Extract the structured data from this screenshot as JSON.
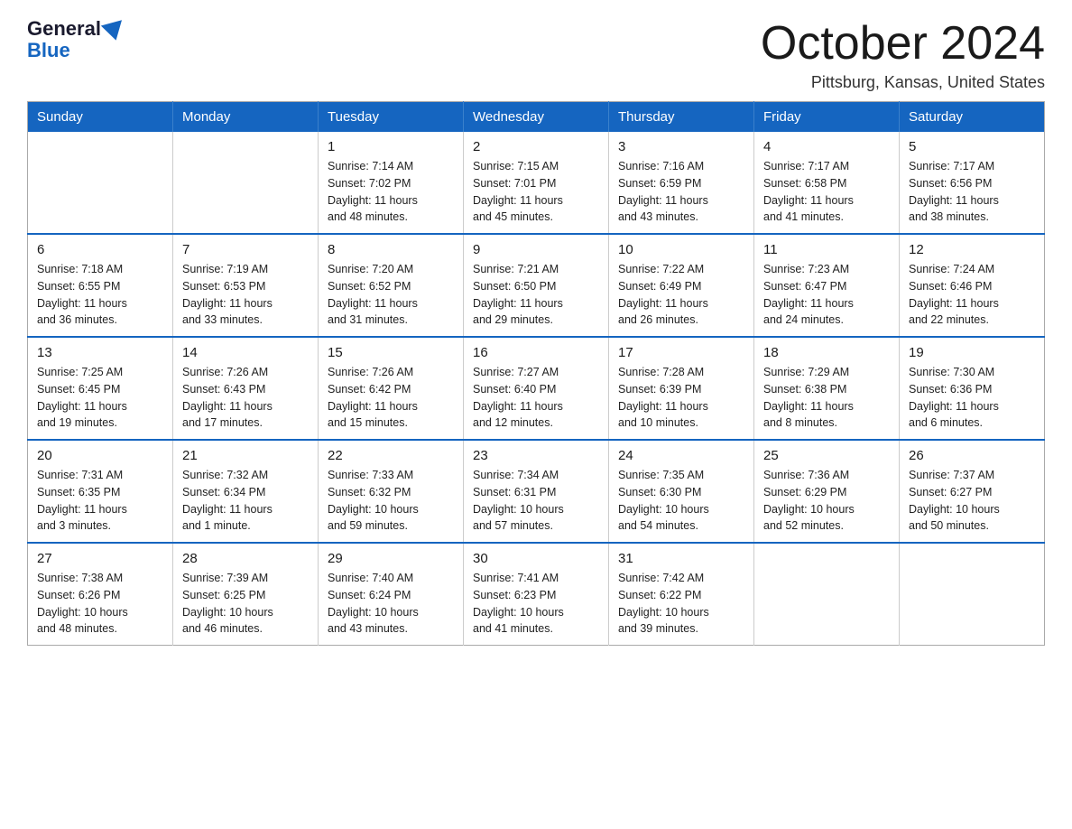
{
  "header": {
    "logo_general": "General",
    "logo_blue": "Blue",
    "month_title": "October 2024",
    "location": "Pittsburg, Kansas, United States"
  },
  "days_of_week": [
    "Sunday",
    "Monday",
    "Tuesday",
    "Wednesday",
    "Thursday",
    "Friday",
    "Saturday"
  ],
  "weeks": [
    [
      {
        "day": "",
        "info": ""
      },
      {
        "day": "",
        "info": ""
      },
      {
        "day": "1",
        "info": "Sunrise: 7:14 AM\nSunset: 7:02 PM\nDaylight: 11 hours\nand 48 minutes."
      },
      {
        "day": "2",
        "info": "Sunrise: 7:15 AM\nSunset: 7:01 PM\nDaylight: 11 hours\nand 45 minutes."
      },
      {
        "day": "3",
        "info": "Sunrise: 7:16 AM\nSunset: 6:59 PM\nDaylight: 11 hours\nand 43 minutes."
      },
      {
        "day": "4",
        "info": "Sunrise: 7:17 AM\nSunset: 6:58 PM\nDaylight: 11 hours\nand 41 minutes."
      },
      {
        "day": "5",
        "info": "Sunrise: 7:17 AM\nSunset: 6:56 PM\nDaylight: 11 hours\nand 38 minutes."
      }
    ],
    [
      {
        "day": "6",
        "info": "Sunrise: 7:18 AM\nSunset: 6:55 PM\nDaylight: 11 hours\nand 36 minutes."
      },
      {
        "day": "7",
        "info": "Sunrise: 7:19 AM\nSunset: 6:53 PM\nDaylight: 11 hours\nand 33 minutes."
      },
      {
        "day": "8",
        "info": "Sunrise: 7:20 AM\nSunset: 6:52 PM\nDaylight: 11 hours\nand 31 minutes."
      },
      {
        "day": "9",
        "info": "Sunrise: 7:21 AM\nSunset: 6:50 PM\nDaylight: 11 hours\nand 29 minutes."
      },
      {
        "day": "10",
        "info": "Sunrise: 7:22 AM\nSunset: 6:49 PM\nDaylight: 11 hours\nand 26 minutes."
      },
      {
        "day": "11",
        "info": "Sunrise: 7:23 AM\nSunset: 6:47 PM\nDaylight: 11 hours\nand 24 minutes."
      },
      {
        "day": "12",
        "info": "Sunrise: 7:24 AM\nSunset: 6:46 PM\nDaylight: 11 hours\nand 22 minutes."
      }
    ],
    [
      {
        "day": "13",
        "info": "Sunrise: 7:25 AM\nSunset: 6:45 PM\nDaylight: 11 hours\nand 19 minutes."
      },
      {
        "day": "14",
        "info": "Sunrise: 7:26 AM\nSunset: 6:43 PM\nDaylight: 11 hours\nand 17 minutes."
      },
      {
        "day": "15",
        "info": "Sunrise: 7:26 AM\nSunset: 6:42 PM\nDaylight: 11 hours\nand 15 minutes."
      },
      {
        "day": "16",
        "info": "Sunrise: 7:27 AM\nSunset: 6:40 PM\nDaylight: 11 hours\nand 12 minutes."
      },
      {
        "day": "17",
        "info": "Sunrise: 7:28 AM\nSunset: 6:39 PM\nDaylight: 11 hours\nand 10 minutes."
      },
      {
        "day": "18",
        "info": "Sunrise: 7:29 AM\nSunset: 6:38 PM\nDaylight: 11 hours\nand 8 minutes."
      },
      {
        "day": "19",
        "info": "Sunrise: 7:30 AM\nSunset: 6:36 PM\nDaylight: 11 hours\nand 6 minutes."
      }
    ],
    [
      {
        "day": "20",
        "info": "Sunrise: 7:31 AM\nSunset: 6:35 PM\nDaylight: 11 hours\nand 3 minutes."
      },
      {
        "day": "21",
        "info": "Sunrise: 7:32 AM\nSunset: 6:34 PM\nDaylight: 11 hours\nand 1 minute."
      },
      {
        "day": "22",
        "info": "Sunrise: 7:33 AM\nSunset: 6:32 PM\nDaylight: 10 hours\nand 59 minutes."
      },
      {
        "day": "23",
        "info": "Sunrise: 7:34 AM\nSunset: 6:31 PM\nDaylight: 10 hours\nand 57 minutes."
      },
      {
        "day": "24",
        "info": "Sunrise: 7:35 AM\nSunset: 6:30 PM\nDaylight: 10 hours\nand 54 minutes."
      },
      {
        "day": "25",
        "info": "Sunrise: 7:36 AM\nSunset: 6:29 PM\nDaylight: 10 hours\nand 52 minutes."
      },
      {
        "day": "26",
        "info": "Sunrise: 7:37 AM\nSunset: 6:27 PM\nDaylight: 10 hours\nand 50 minutes."
      }
    ],
    [
      {
        "day": "27",
        "info": "Sunrise: 7:38 AM\nSunset: 6:26 PM\nDaylight: 10 hours\nand 48 minutes."
      },
      {
        "day": "28",
        "info": "Sunrise: 7:39 AM\nSunset: 6:25 PM\nDaylight: 10 hours\nand 46 minutes."
      },
      {
        "day": "29",
        "info": "Sunrise: 7:40 AM\nSunset: 6:24 PM\nDaylight: 10 hours\nand 43 minutes."
      },
      {
        "day": "30",
        "info": "Sunrise: 7:41 AM\nSunset: 6:23 PM\nDaylight: 10 hours\nand 41 minutes."
      },
      {
        "day": "31",
        "info": "Sunrise: 7:42 AM\nSunset: 6:22 PM\nDaylight: 10 hours\nand 39 minutes."
      },
      {
        "day": "",
        "info": ""
      },
      {
        "day": "",
        "info": ""
      }
    ]
  ]
}
